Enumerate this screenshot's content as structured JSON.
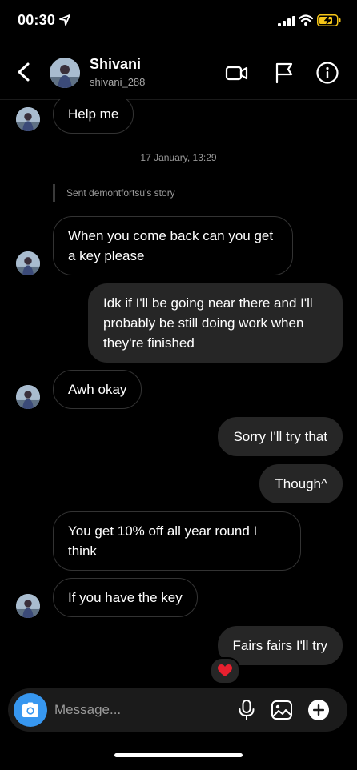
{
  "status_bar": {
    "time": "00:30"
  },
  "header": {
    "name": "Shivani",
    "username": "shivani_288"
  },
  "chat": {
    "messages": [
      {
        "side": "in",
        "text": "Help me"
      },
      {
        "side": "in",
        "text": "When you come back can you get a key please"
      },
      {
        "side": "out",
        "text": "Idk if I'll be going near there and I'll probably be still doing work when they're finished"
      },
      {
        "side": "in",
        "text": "Awh okay"
      },
      {
        "side": "out",
        "text": "Sorry I'll try that"
      },
      {
        "side": "out",
        "text": "Though^"
      },
      {
        "side": "in",
        "text": "You get 10% off all year round I think"
      },
      {
        "side": "in",
        "text": "If you have the key"
      },
      {
        "side": "out",
        "text": "Fairs fairs I'll try",
        "reaction": "❤️"
      }
    ],
    "timestamp": "17 January, 13:29",
    "story_note": "Sent demontfortsu's story"
  },
  "composer": {
    "placeholder": "Message..."
  },
  "colors": {
    "accent": "#3797f0",
    "outgoing_bubble": "#262626",
    "background": "#000000"
  }
}
